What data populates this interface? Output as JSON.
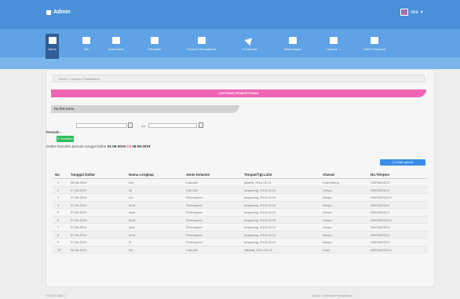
{
  "topbar": {
    "brand": "Admin",
    "user": "oka"
  },
  "nav": [
    {
      "label": "Home",
      "icon": "home-icon",
      "active": true
    },
    {
      "label": "Info",
      "icon": "megaphone-icon"
    },
    {
      "label": "Data Admin",
      "icon": "user-icon"
    },
    {
      "label": "Pendaftar",
      "icon": "users-icon"
    },
    {
      "label": "Formulir Pendaftaran",
      "icon": "file-icon"
    },
    {
      "label": "Konfirmasi",
      "icon": "send-icon"
    },
    {
      "label": "Status Bayar",
      "icon": "money-icon"
    },
    {
      "label": "Laporan ⌄",
      "icon": "briefcase-icon"
    },
    {
      "label": "Ganti Password",
      "icon": "cogs-icon"
    }
  ],
  "breadcrumb": "Home  >  Laporan Pendaftaran",
  "banner": "LAPORAN PENDAFTARAN",
  "filter_title": "FILTER DATA",
  "sd": "s/d",
  "periode": "Periode :",
  "tampilkan": "⟳ Tampilkan",
  "info": {
    "prefix": "Daftar transaksi periode tanggal daftar ",
    "from": "01-06-2019",
    "sd": "s/d",
    "to": "08-06-2019"
  },
  "cetak": "⎙ Cetak Laporan",
  "columns": [
    "No",
    "Tanggal Daftar",
    "Nama Lengkap",
    "Jenis Kelamin",
    "Tempat/Tgl.Lahir",
    "Alamat",
    "No.Telepon"
  ],
  "rows": [
    [
      "1",
      "08-06-2019",
      "eko",
      "Laki-laki",
      "jakarta, 2014-01-01",
      "Kota Bitung",
      "09876543212"
    ],
    [
      "2",
      "07-06-2019",
      "uti",
      "Laki-laki",
      "tangerang, 2014-01-01",
      "cikupa",
      "09876543212"
    ],
    [
      "3",
      "07-06-2019",
      "eni",
      "Perempuan",
      "tangerang, 2014-01-01",
      "cikupa",
      "098765432123"
    ],
    [
      "4",
      "07-06-2019",
      "dewi",
      "Perempuan",
      "tangerang, 2014-01-01",
      "cikupa",
      "09876543212"
    ],
    [
      "5",
      "07-06-2019",
      "dewi",
      "Perempuan",
      "tangerang, 2014-01-01",
      "cikupa",
      "09876543212"
    ],
    [
      "6",
      "07-06-2019",
      "dewi",
      "Perempuan",
      "tangerang, 2014-01-01",
      "cikupa",
      "098765432123"
    ],
    [
      "7",
      "07-06-2019",
      "desi",
      "Perempuan",
      "tangerang, 2014-01-01",
      "cikupa",
      "09876543212"
    ],
    [
      "8",
      "07-06-2019",
      "dewi",
      "Perempuan",
      "tangerang, 2014-01-01",
      "cikupa",
      "09876543212"
    ],
    [
      "9",
      "07-06-2019",
      "ili",
      "Perempuan",
      "tangerang, 2014-01-01",
      "cikupa",
      "09876543212"
    ],
    [
      "10",
      "08-06-2019",
      "Ati",
      "Laki-laki",
      "Jakarta, 2014-02-02",
      "Kadu",
      "098765432123"
    ]
  ],
  "footer": {
    "left": "© 2019 UBD  |",
    "right": "About  |  Website Pendaftaran"
  }
}
